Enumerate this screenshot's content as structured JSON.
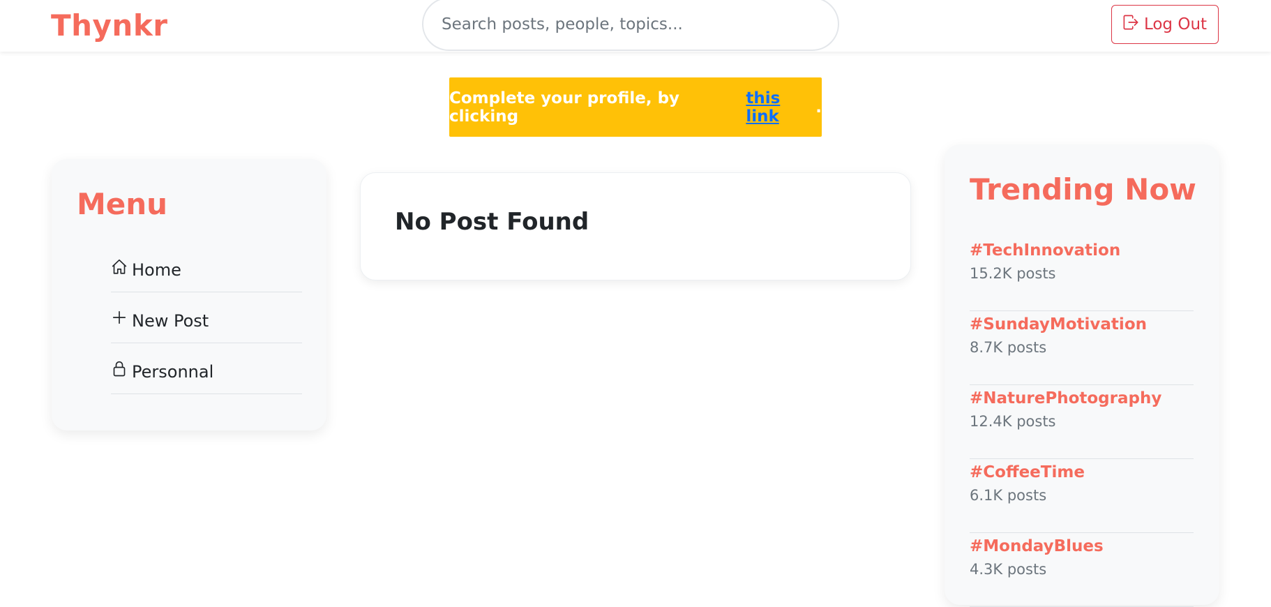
{
  "brand": {
    "name": "Thynkr",
    "color": "#f56b5c"
  },
  "search": {
    "placeholder": "Search posts, people, topics..."
  },
  "header": {
    "logout_label": "Log Out",
    "logout_icon": "box-arrow-right-icon"
  },
  "alert": {
    "text": "Complete your profile, by clicking",
    "link_text": "this link",
    "suffix": ".",
    "color": "#ffc107"
  },
  "menu": {
    "title": "Menu",
    "items": [
      {
        "label": "Home",
        "icon": "house-icon"
      },
      {
        "label": "New Post",
        "icon": "plus-icon"
      },
      {
        "label": "Personnal",
        "icon": "lock-icon"
      }
    ]
  },
  "feed": {
    "empty_message": "No Post Found"
  },
  "trending": {
    "title": "Trending Now",
    "items": [
      {
        "tag": "#TechInnovation",
        "count": "15.2K posts"
      },
      {
        "tag": "#SundayMotivation",
        "count": "8.7K posts"
      },
      {
        "tag": "#NaturePhotography",
        "count": "12.4K posts"
      },
      {
        "tag": "#CoffeeTime",
        "count": "6.1K posts"
      },
      {
        "tag": "#MondayBlues",
        "count": "4.3K posts"
      }
    ]
  }
}
